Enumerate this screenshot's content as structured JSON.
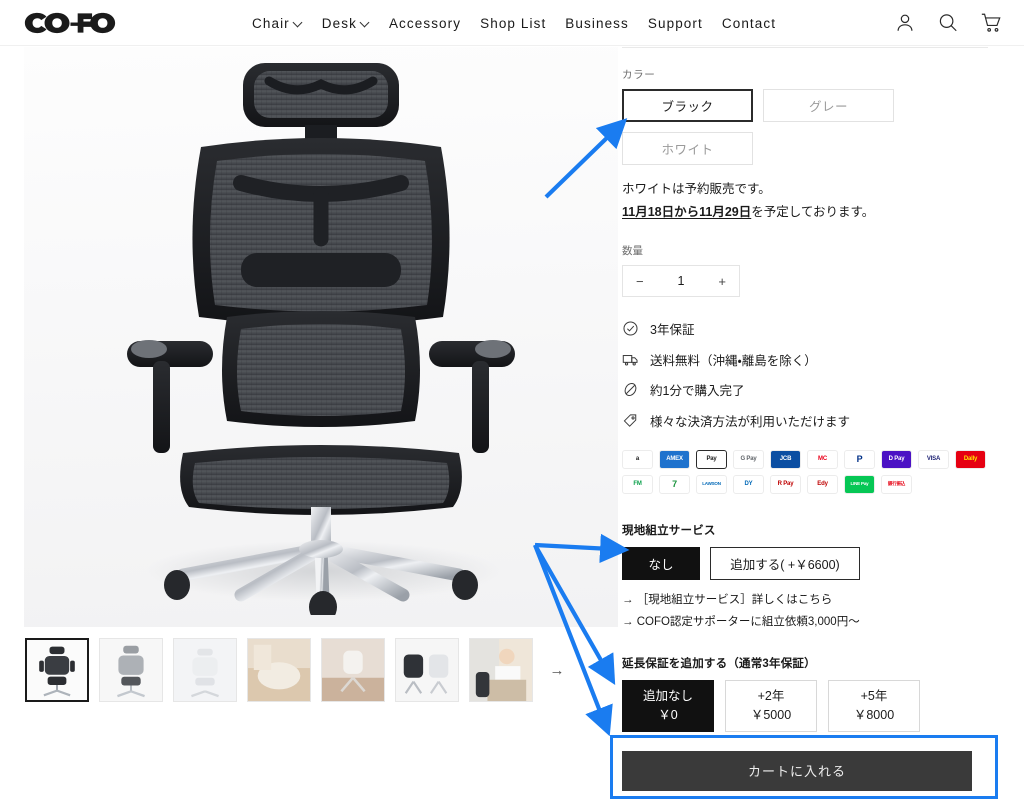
{
  "header": {
    "logo_text": "COFO",
    "nav": [
      {
        "label": "Chair",
        "has_dropdown": true
      },
      {
        "label": "Desk",
        "has_dropdown": true
      },
      {
        "label": "Accessory",
        "has_dropdown": false
      },
      {
        "label": "Shop List",
        "has_dropdown": false
      },
      {
        "label": "Business",
        "has_dropdown": false
      },
      {
        "label": "Support",
        "has_dropdown": false
      },
      {
        "label": "Contact",
        "has_dropdown": false
      }
    ],
    "icons": [
      "account-icon",
      "search-icon",
      "cart-icon"
    ]
  },
  "gallery": {
    "main_image_alt": "黒メッシュ エルゴノミクスチェア（ヘッドレスト・オットマン付き）",
    "thumbnails": [
      {
        "alt": "チェア正面 ブラック",
        "selected": true
      },
      {
        "alt": "チェア正面 グレー",
        "selected": false
      },
      {
        "alt": "チェア ホワイト",
        "selected": false
      },
      {
        "alt": "室内イメージ ベージュ",
        "selected": false
      },
      {
        "alt": "チェア斜め ホワイト",
        "selected": false
      },
      {
        "alt": "チェア2台 ブラック・ホワイト",
        "selected": false
      },
      {
        "alt": "女性がチェアでリクライニング",
        "selected": false
      }
    ],
    "next_arrow": "→"
  },
  "panel": {
    "color": {
      "label": "カラー",
      "options": [
        {
          "label": "ブラック",
          "selected": true
        },
        {
          "label": "グレー",
          "selected": false
        },
        {
          "label": "ホワイト",
          "selected": false
        }
      ]
    },
    "preorder_note_line1": "ホワイトは予約販売です。",
    "preorder_note_dates": "11月18日から11月29日",
    "preorder_note_line2": "を予定しております。",
    "quantity": {
      "label": "数量",
      "minus": "−",
      "value": "1",
      "plus": "+"
    },
    "benefits": [
      {
        "icon": "check-circle-icon",
        "text": "3年保証"
      },
      {
        "icon": "truck-icon",
        "text": "送料無料（沖縄・離島を除く）"
      },
      {
        "icon": "speed-icon",
        "text": "約1分で購入完了"
      },
      {
        "icon": "tag-icon",
        "text": "様々な決済方法が利用いただけます"
      }
    ],
    "payments": {
      "row1": [
        {
          "name": "amazon-pay",
          "text": "a",
          "fg": "#111",
          "bg": "#ffffff"
        },
        {
          "name": "amex",
          "text": "AMEX",
          "fg": "#ffffff",
          "bg": "#1f72cd"
        },
        {
          "name": "apple-pay",
          "text": "Pay",
          "fg": "#111",
          "bg": "#ffffff"
        },
        {
          "name": "google-pay",
          "text": "G Pay",
          "fg": "#5f6368",
          "bg": "#ffffff"
        },
        {
          "name": "jcb",
          "text": "JCB",
          "fg": "#ffffff",
          "bg": "#0b4ea2"
        },
        {
          "name": "mastercard",
          "text": "MC",
          "fg": "#eb001b",
          "bg": "#ffffff"
        },
        {
          "name": "paypal",
          "text": "P",
          "fg": "#003087",
          "bg": "#ffffff"
        },
        {
          "name": "d-pay",
          "text": "D Pay",
          "fg": "#ffffff",
          "bg": "#4b12c4"
        },
        {
          "name": "visa",
          "text": "VISA",
          "fg": "#1a1f71",
          "bg": "#ffffff"
        },
        {
          "name": "dally",
          "text": "Dally",
          "fg": "#ffe600",
          "bg": "#e60012"
        }
      ],
      "row2": [
        {
          "name": "familymart",
          "text": "FM",
          "fg": "#0aa04b",
          "bg": "#ffffff"
        },
        {
          "name": "seven-eleven",
          "text": "7",
          "fg": "#19933c",
          "bg": "#ffffff"
        },
        {
          "name": "lawson",
          "text": "LAWSON",
          "fg": "#0068b7",
          "bg": "#ffffff"
        },
        {
          "name": "daily-yamazaki",
          "text": "DY",
          "fg": "#0068b7",
          "bg": "#ffffff"
        },
        {
          "name": "rakuten-pay",
          "text": "R Pay",
          "fg": "#bf0000",
          "bg": "#ffffff"
        },
        {
          "name": "rakuten-edy",
          "text": "Edy",
          "fg": "#bf0000",
          "bg": "#ffffff"
        },
        {
          "name": "line-pay",
          "text": "LINE Pay",
          "fg": "#ffffff",
          "bg": "#06c755"
        },
        {
          "name": "bank-transfer",
          "text": "銀行振込",
          "fg": "#e60012",
          "bg": "#ffffff"
        }
      ]
    },
    "assembly": {
      "title": "現地組立サービス",
      "options": [
        {
          "label": "なし",
          "selected": true
        },
        {
          "label": "追加する( +￥6600)",
          "selected": false
        }
      ],
      "links": [
        "→ ［現地組立サービス］詳しくはこちら",
        "→ COFO認定サポーターに組立依頼3,000円〜"
      ]
    },
    "warranty": {
      "title": "延長保証を追加する（通常3年保証）",
      "options": [
        {
          "line1": "追加なし",
          "line2": "￥0",
          "selected": true
        },
        {
          "line1": "+2年",
          "line2": "￥5000",
          "selected": false
        },
        {
          "line1": "+5年",
          "line2": "￥8000",
          "selected": false
        }
      ]
    },
    "cart_button": "カートに入れる"
  },
  "annotations": {
    "accent_color": "#1a7cf0",
    "highlight_target": "カートに入れる",
    "arrow_count": 4
  }
}
